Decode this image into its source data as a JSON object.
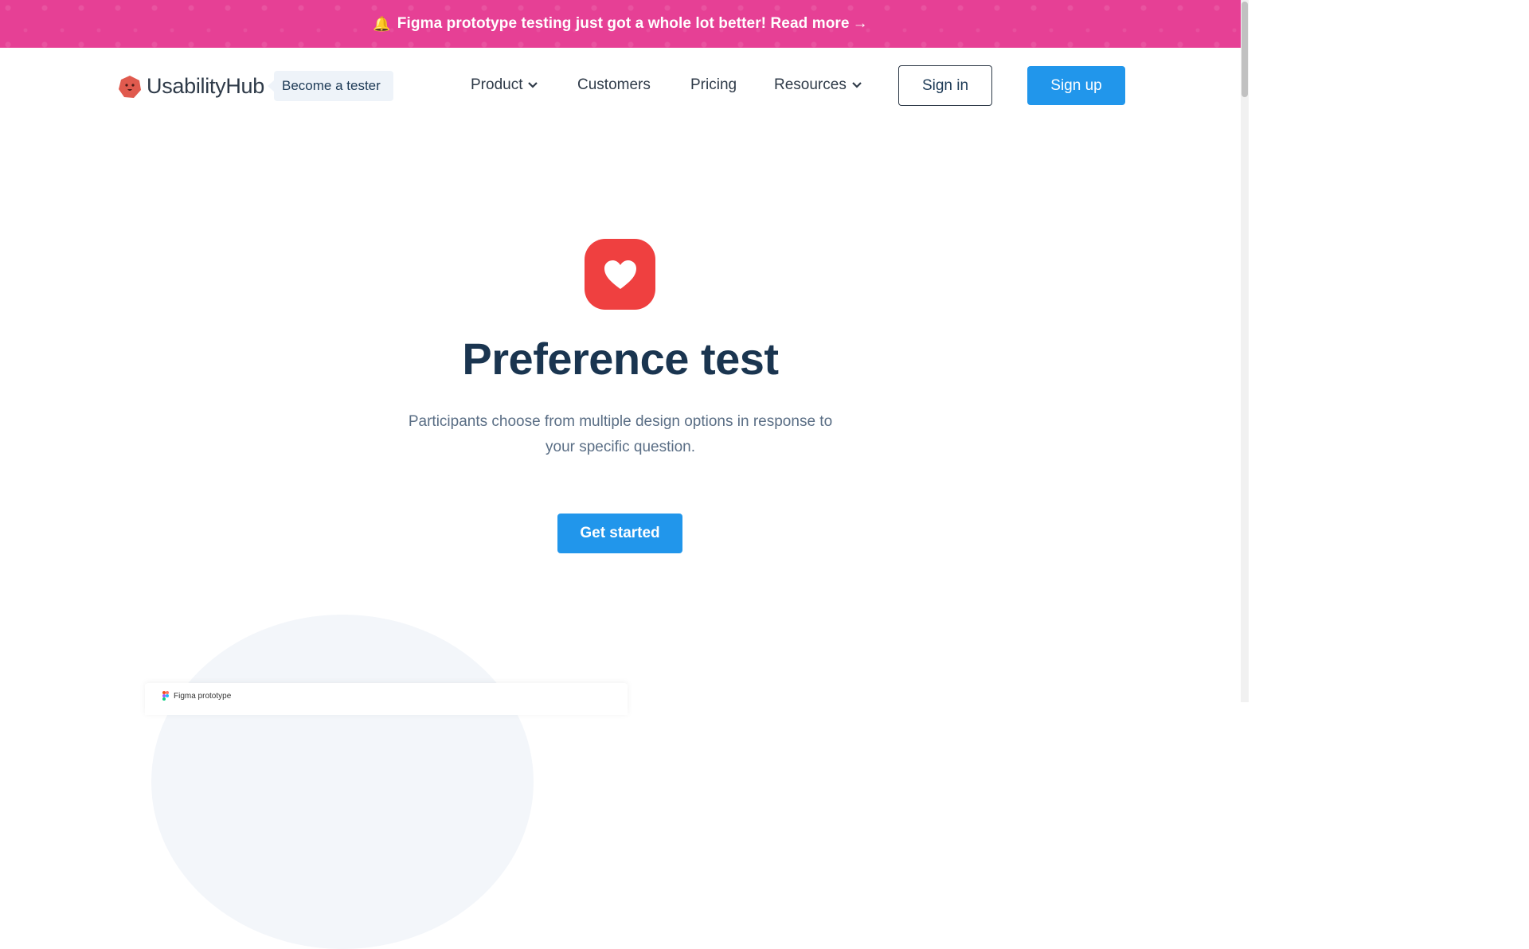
{
  "banner": {
    "icon": "bell-icon",
    "text": "Figma prototype testing just got a whole lot better! Read more",
    "arrow": "→",
    "color": "#e64095"
  },
  "header": {
    "logo_text": "UsabilityHub",
    "become_tester": "Become a tester",
    "nav": {
      "product": "Product",
      "customers": "Customers",
      "pricing": "Pricing",
      "resources": "Resources"
    },
    "sign_in": "Sign in",
    "sign_up": "Sign up"
  },
  "hero": {
    "icon": "heart-icon",
    "title": "Preference test",
    "subtitle": "Participants choose from multiple design options in response to your specific question.",
    "cta": "Get started",
    "accent": "#2196eb",
    "icon_color": "#ef4040"
  },
  "preview": {
    "tab_label": "Figma prototype"
  }
}
